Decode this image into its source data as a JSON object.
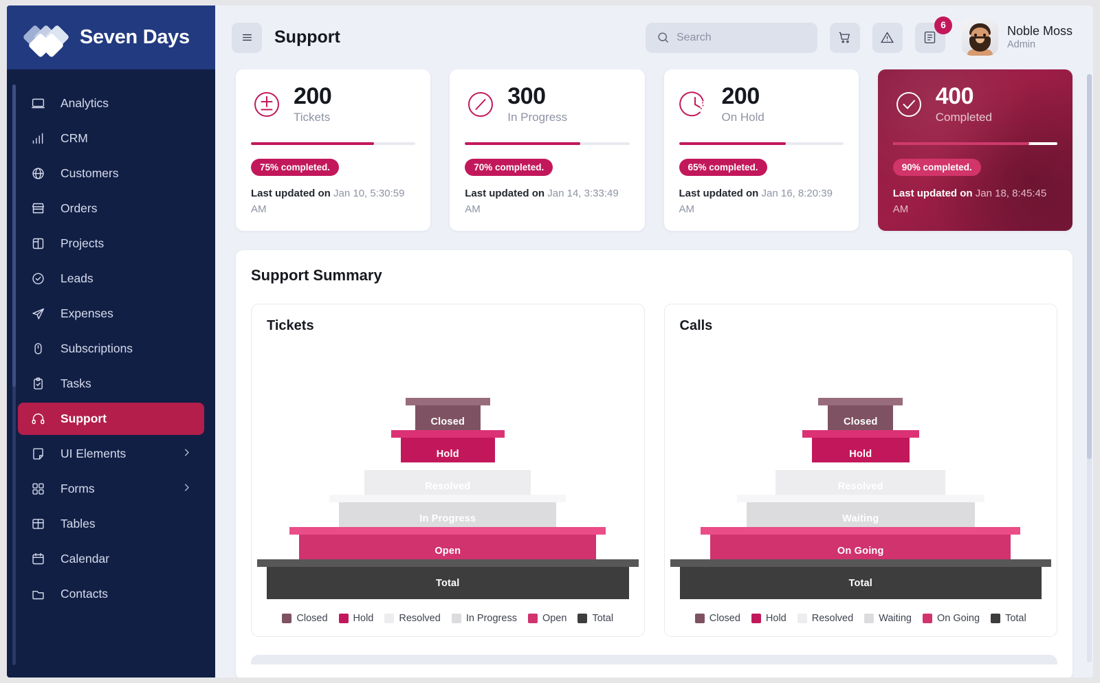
{
  "brand": {
    "name": "Seven Days",
    "logo_icon": "diamonds-logo-icon"
  },
  "sidebar": {
    "items": [
      {
        "label": "Analytics",
        "icon": "laptop-icon",
        "active": false,
        "expandable": false
      },
      {
        "label": "CRM",
        "icon": "bar-chart-icon",
        "active": false,
        "expandable": false
      },
      {
        "label": "Customers",
        "icon": "globe-icon",
        "active": false,
        "expandable": false
      },
      {
        "label": "Orders",
        "icon": "store-icon",
        "active": false,
        "expandable": false
      },
      {
        "label": "Projects",
        "icon": "layout-icon",
        "active": false,
        "expandable": false
      },
      {
        "label": "Leads",
        "icon": "badge-check-icon",
        "active": false,
        "expandable": false
      },
      {
        "label": "Expenses",
        "icon": "send-icon",
        "active": false,
        "expandable": false
      },
      {
        "label": "Subscriptions",
        "icon": "mouse-icon",
        "active": false,
        "expandable": false
      },
      {
        "label": "Tasks",
        "icon": "clipboard-check-icon",
        "active": false,
        "expandable": false
      },
      {
        "label": "Support",
        "icon": "headset-icon",
        "active": true,
        "expandable": false
      },
      {
        "label": "UI Elements",
        "icon": "sticky-note-icon",
        "active": false,
        "expandable": true
      },
      {
        "label": "Forms",
        "icon": "form-grid-icon",
        "active": false,
        "expandable": true
      },
      {
        "label": "Tables",
        "icon": "table-icon",
        "active": false,
        "expandable": false
      },
      {
        "label": "Calendar",
        "icon": "calendar-icon",
        "active": false,
        "expandable": false
      },
      {
        "label": "Contacts",
        "icon": "folder-icon",
        "active": false,
        "expandable": false
      }
    ]
  },
  "topbar": {
    "menu_icon": "hamburger-icon",
    "page_title": "Support",
    "search": {
      "icon": "search-icon",
      "value": "",
      "placeholder": "Search"
    },
    "actions": [
      {
        "icon": "cart-icon",
        "name": "cart-button",
        "badge": ""
      },
      {
        "icon": "alert-triangle-icon",
        "name": "alerts-button",
        "badge": ""
      },
      {
        "icon": "document-icon",
        "name": "notes-button",
        "badge": "6"
      }
    ],
    "profile": {
      "name": "Noble Moss",
      "role": "Admin",
      "avatar": "user-avatar"
    }
  },
  "stats": [
    {
      "icon": "plus-minus-circle-icon",
      "value": "200",
      "label": "Tickets",
      "progress": 75,
      "pill": "75% completed.",
      "updated_prefix": "Last updated on",
      "updated_value": "Jan 10, 5:30:59 AM",
      "highlighted": false
    },
    {
      "icon": "slash-circle-icon",
      "value": "300",
      "label": "In Progress",
      "progress": 70,
      "pill": "70% completed.",
      "updated_prefix": "Last updated on",
      "updated_value": "Jan 14, 3:33:49 AM",
      "highlighted": false
    },
    {
      "icon": "clock-dashed-icon",
      "value": "200",
      "label": "On Hold",
      "progress": 65,
      "pill": "65% completed.",
      "updated_prefix": "Last updated on",
      "updated_value": "Jan 16, 8:20:39 AM",
      "highlighted": false
    },
    {
      "icon": "check-circle-icon",
      "value": "400",
      "label": "Completed",
      "progress": 83,
      "pill": "90% completed.",
      "updated_prefix": "Last updated on",
      "updated_value": "Jan 18, 8:45:45 AM",
      "highlighted": true
    }
  ],
  "summary": {
    "title": "Support Summary"
  },
  "colors": {
    "accent": "#c2185b",
    "sidebar": "#121f45",
    "brand_bar": "#223a80",
    "closed": "#7e5262",
    "hold": "#c2185b",
    "resolved": "#ededef",
    "in_progress": "#dcdcde",
    "open": "#d0336e",
    "total": "#3d3d3d",
    "waiting": "#dcdcde",
    "on_going": "#d0336e"
  },
  "chart_data": [
    {
      "type": "funnel",
      "title": "Tickets",
      "categories": [
        "Closed",
        "Hold",
        "Resolved",
        "In Progress",
        "Open",
        "Total"
      ],
      "widths_pct": [
        18,
        26,
        46,
        60,
        82,
        100
      ],
      "colors": [
        "#7e5262",
        "#c2185b",
        "#ededef",
        "#dcdcde",
        "#d0336e",
        "#3d3d3d"
      ],
      "legend": [
        "Closed",
        "Hold",
        "Resolved",
        "In Progress",
        "Open",
        "Total"
      ],
      "legend_position": "bottom",
      "xlabel": "",
      "ylabel": ""
    },
    {
      "type": "funnel",
      "title": "Calls",
      "categories": [
        "Closed",
        "Hold",
        "Resolved",
        "Waiting",
        "On Going",
        "Total"
      ],
      "widths_pct": [
        18,
        27,
        47,
        63,
        83,
        100
      ],
      "colors": [
        "#7e5262",
        "#c2185b",
        "#ededef",
        "#dcdcde",
        "#d0336e",
        "#3d3d3d"
      ],
      "legend": [
        "Closed",
        "Hold",
        "Resolved",
        "Waiting",
        "On Going",
        "Total"
      ],
      "legend_position": "bottom",
      "xlabel": "",
      "ylabel": ""
    }
  ]
}
